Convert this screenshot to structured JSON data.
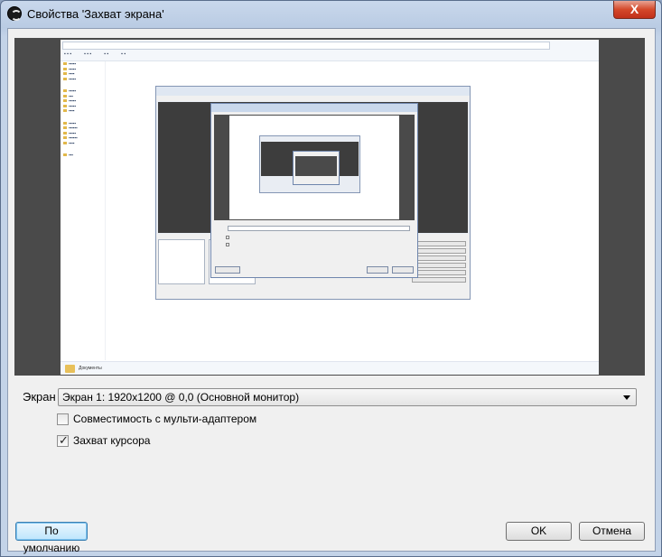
{
  "window": {
    "title": "Свойства 'Захват экрана'",
    "close_glyph": "X"
  },
  "preview": {
    "status_text": "Документы"
  },
  "fields": {
    "screen_label": "Экран",
    "screen_value": "Экран 1: 1920x1200 @ 0,0 (Основной монитор)"
  },
  "options": [
    {
      "label": "Совместимость с мульти-адаптером",
      "checked": false
    },
    {
      "label": "Захват курсора",
      "checked": true
    }
  ],
  "buttons": {
    "defaults": "По умолчанию",
    "ok": "OK",
    "cancel": "Отмена"
  }
}
